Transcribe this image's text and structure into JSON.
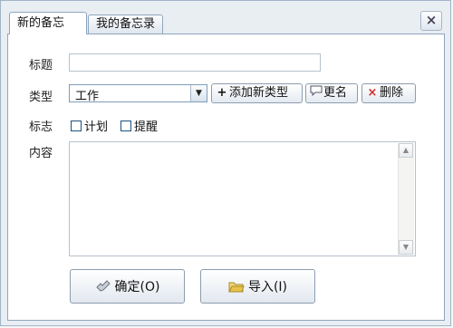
{
  "tabs": [
    {
      "label": "新的备忘"
    },
    {
      "label": "我的备忘录"
    }
  ],
  "close_label": "×",
  "form": {
    "title_label": "标题",
    "title_value": "",
    "type_label": "类型",
    "type_value": "工作",
    "flag_label": "标志",
    "flags": [
      {
        "label": "计划",
        "checked": false
      },
      {
        "label": "提醒",
        "checked": false
      }
    ],
    "content_label": "内容",
    "content_value": ""
  },
  "type_buttons": {
    "add_label": "添加新类型",
    "rename_label": "更名",
    "delete_label": "删除"
  },
  "footer": {
    "ok_label": "确定(O)",
    "import_label": "导入(I)"
  },
  "colors": {
    "accent": "#1c5180",
    "delete_icon": "#d12b2b",
    "folder_icon": "#e8c34a"
  }
}
